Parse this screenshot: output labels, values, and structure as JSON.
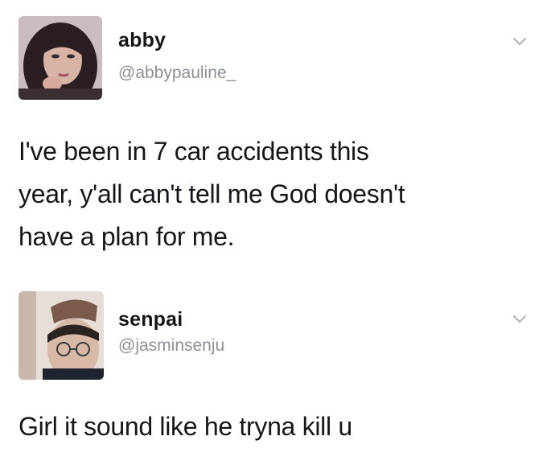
{
  "tweets": [
    {
      "display_name": "abby",
      "handle": "@abbypauline_",
      "avatar_icon": "profile-photo",
      "menu_icon": "chevron-down-icon",
      "text_lines": [
        "I've been in 7 car accidents this",
        "year, y'all can't tell me God doesn't",
        "have a plan for me."
      ]
    },
    {
      "display_name": "senpai",
      "handle": "@jasminsenju",
      "avatar_icon": "profile-photo",
      "menu_icon": "chevron-down-icon",
      "text_lines": [
        "Girl it sound like he tryna kill u"
      ]
    }
  ],
  "colors": {
    "text": "#14171a",
    "secondary_text": "#8a9199",
    "background": "#ffffff",
    "caret": "#aab2b9"
  }
}
